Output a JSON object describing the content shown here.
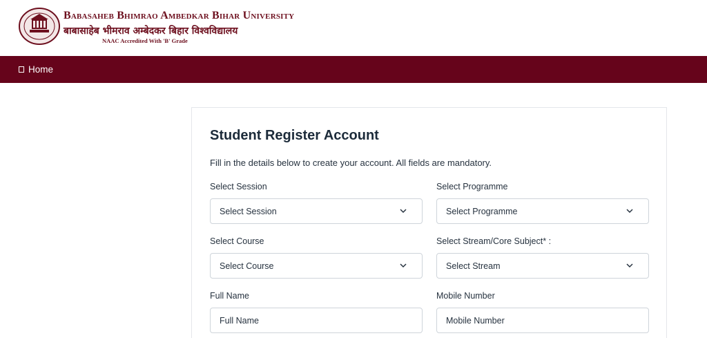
{
  "header": {
    "university_name_en": "Babasaheb Bhimrao Ambedkar Bihar University",
    "university_name_hi": "बाबासाहेब भीमराव अम्बेदकर बिहार विश्वविद्यालय",
    "accreditation": "NAAC Accredited With 'B' Grade"
  },
  "nav": {
    "home_label": "Home"
  },
  "form": {
    "title": "Student Register Account",
    "subtitle": "Fill in the details below to create your account. All fields are mandatory.",
    "session": {
      "label": "Select Session",
      "value": "Select Session"
    },
    "programme": {
      "label": "Select Programme",
      "value": "Select Programme"
    },
    "course": {
      "label": "Select Course",
      "value": "Select Course"
    },
    "stream": {
      "label": "Select Stream/Core Subject* :",
      "value": "Select Stream"
    },
    "full_name": {
      "label": "Full Name",
      "placeholder": "Full Name"
    },
    "mobile": {
      "label": "Mobile Number",
      "placeholder": "Mobile Number"
    }
  },
  "colors": {
    "brand": "#66041b",
    "text": "#1c2b3a",
    "border": "#ced4da"
  }
}
